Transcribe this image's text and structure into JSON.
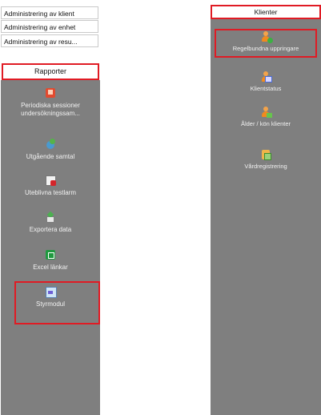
{
  "left": {
    "headers": [
      "Administrering av klient",
      "Administrering av enhet",
      "Administrering av resu..."
    ],
    "section": "Rapporter",
    "tools": [
      {
        "label": "Periodiska sessioner",
        "label2": "undersökningssam...",
        "icon": "report-icon"
      },
      {
        "label": "Utgående samtal",
        "icon": "outgoing-call-icon"
      },
      {
        "label": "Uteblivna testlarm",
        "icon": "missed-alarm-icon"
      },
      {
        "label": "Exportera data",
        "icon": "export-icon"
      },
      {
        "label": "Excel länkar",
        "icon": "excel-icon"
      },
      {
        "label": "Styrmodul",
        "icon": "control-module-icon"
      }
    ]
  },
  "right": {
    "section": "Klienter",
    "tools": [
      {
        "label": "Regelbundna uppringare",
        "icon": "regular-callers-icon"
      },
      {
        "label": "Klientstatus",
        "icon": "client-status-icon"
      },
      {
        "label": "Ålder / kön klienter",
        "icon": "age-gender-icon"
      },
      {
        "label": "Vårdregistrering",
        "icon": "care-registration-icon"
      }
    ]
  },
  "colors": {
    "highlight": "#e01b24",
    "panel": "#7f7f7f"
  }
}
